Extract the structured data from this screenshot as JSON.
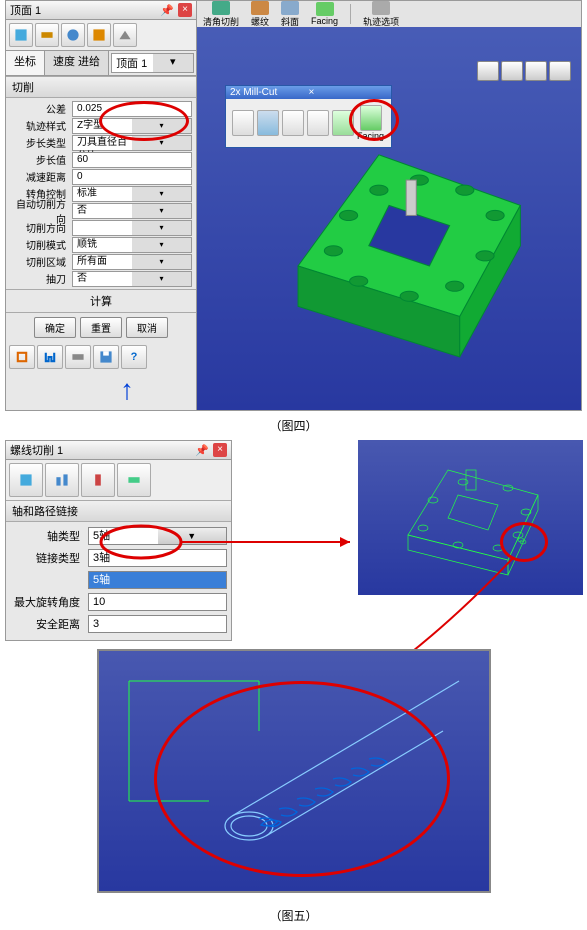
{
  "fig1": {
    "panel_title": "顶面 1",
    "tabs": {
      "a": "坐标",
      "b": "速度 进给"
    },
    "dropdown": "顶面 1",
    "section": "切削",
    "params": [
      {
        "label": "公差",
        "value": "0.025"
      },
      {
        "label": "轨迹样式",
        "value": "Z字型",
        "dd": true
      },
      {
        "label": "步长类型",
        "value": "刀具直径百分比",
        "dd": true
      },
      {
        "label": "步长值",
        "value": "60"
      },
      {
        "label": "减速距离",
        "value": "0"
      },
      {
        "label": "转角控制",
        "value": "标准",
        "dd": true
      },
      {
        "label": "自动切削方向",
        "value": "否",
        "dd": true
      },
      {
        "label": "切削方向",
        "value": "",
        "dd": true
      },
      {
        "label": "切削模式",
        "value": "顺铣",
        "dd": true
      },
      {
        "label": "切削区域",
        "value": "所有面",
        "dd": true
      },
      {
        "label": "抽刀",
        "value": "否",
        "dd": true
      }
    ],
    "calc": "计算",
    "btns": {
      "ok": "确定",
      "reset": "重置",
      "cancel": "取消"
    },
    "strip": [
      {
        "label": "清角切削"
      },
      {
        "label": "螺纹"
      },
      {
        "label": "斜面"
      },
      {
        "label": "Facing"
      },
      {
        "label": "轨迹选项"
      }
    ],
    "mill": {
      "title": "2x Mill-Cut",
      "facing": "Facing"
    }
  },
  "caption1": "（图四）",
  "fig2": {
    "panel_title": "螺线切削 1",
    "section": "轴和路径链接",
    "rows": [
      {
        "label": "轴类型",
        "value": "5轴",
        "dd": true
      },
      {
        "label": "链接类型",
        "value": "3轴",
        "list": true
      },
      {
        "label": "",
        "value": "5轴",
        "hl": true
      },
      {
        "label": "最大旋转角度",
        "value": "10"
      },
      {
        "label": "安全距离",
        "value": "3"
      }
    ]
  },
  "caption2": "（图五）"
}
